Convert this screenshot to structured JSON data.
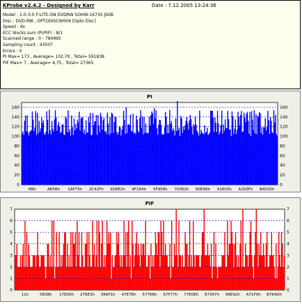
{
  "info": {
    "title": "KProbe v2.4.2 - Designed by Karr",
    "date": "Date : 7.12.2005 13:24:36",
    "lines": [
      "Model : 1-0-3-0 F:LITE-ON DVDRW SOHW-1673S JS0B",
      "Disc : DVD-RW , OPTODISCW004 [Opto Disc]",
      "Speed : 4x",
      "ECC blocks sum (PI/PIF) : 8/1",
      "Scanned range : 0 - 784995",
      "Sampling count : 43507",
      "Errors : 0",
      "PI Max= 173 , Average= 102,70 , Total= 591838",
      "PIF Max= 7 , Average= 4,75 , Total= 27365"
    ]
  },
  "colors": {
    "pi": "#0000ff",
    "pif": "#ff0000",
    "grid": "#0000c0",
    "panel": "#f0efe8",
    "plot_bg": "#ffffff"
  },
  "chart_data": [
    {
      "type": "bar",
      "title": "PI",
      "ylim": [
        0,
        170
      ],
      "yticks": [
        0,
        20,
        40,
        60,
        80,
        100,
        120,
        140,
        160
      ],
      "xticks": [
        "6Bh",
        "AE5Bh",
        "1AF73h",
        "2C42Fh",
        "3D8E2h",
        "4F164h",
        "5F958h",
        "70362h",
        "80E96h",
        "91603h",
        "A293Fh",
        "B4033h"
      ],
      "grid": true,
      "sampled": {
        "n": 300,
        "baseline": 120,
        "typical_range": [
          110,
          150
        ],
        "spikes": [
          {
            "pos": 0.61,
            "value": 173
          },
          {
            "pos": 0.41,
            "value": 160
          },
          {
            "pos": 0.52,
            "value": 158
          },
          {
            "pos": 0.11,
            "value": 155
          },
          {
            "pos": 0.9,
            "value": 152
          }
        ],
        "end_drop": 100
      }
    },
    {
      "type": "bar",
      "title": "PIF",
      "ylim": [
        0,
        7
      ],
      "yticks": [
        0,
        1,
        2,
        3,
        4,
        5,
        6,
        7
      ],
      "xticks": [
        "11h",
        "5E08h",
        "17E00h",
        "276E3h",
        "366F1h",
        "47E7Eh",
        "57766h",
        "67F77h",
        "77E0Eh",
        "87347h",
        "96E92h",
        "A71F0h",
        "B764Dh"
      ],
      "grid": true,
      "sampled": {
        "n": 300,
        "values_range": [
          1,
          7
        ],
        "common": [
          2,
          3,
          4,
          5
        ],
        "max": 7
      }
    }
  ]
}
